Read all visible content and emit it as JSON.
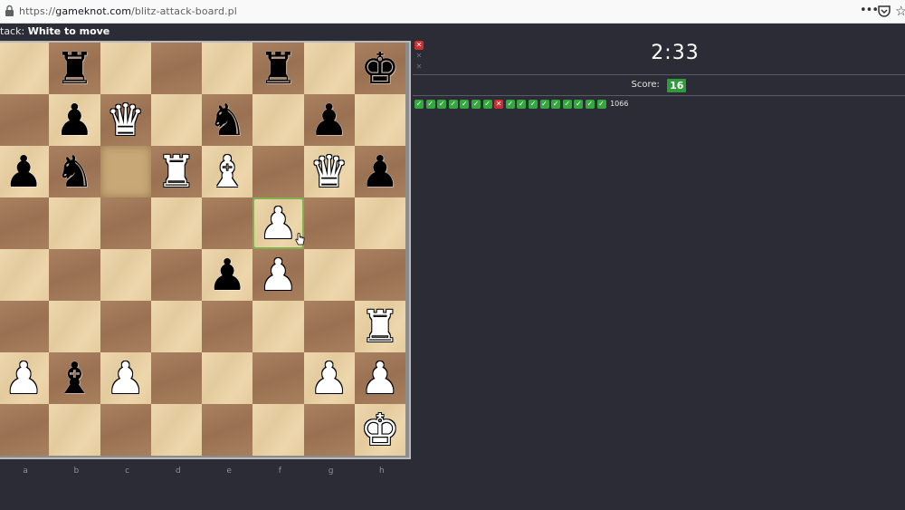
{
  "browser": {
    "url_prefix": "https://",
    "url_host": "gameknot.com",
    "url_path": "/blitz-attack-board.pl",
    "icons": [
      "lock-icon",
      "more-icon",
      "pocket-icon",
      "star-icon"
    ]
  },
  "puzzle": {
    "mode_label": "tack:",
    "turn_label": "White to move"
  },
  "board": {
    "files": [
      "a",
      "b",
      "c",
      "d",
      "e",
      "f",
      "g",
      "h"
    ],
    "rows": [
      [
        "",
        "bR",
        "",
        "",
        "",
        "bR",
        "",
        "bK"
      ],
      [
        "",
        "bP",
        "wQ",
        "",
        "bN",
        "",
        "bP",
        ""
      ],
      [
        "bP",
        "bN",
        "",
        "wR",
        "wB",
        "",
        "wQ",
        "bP"
      ],
      [
        "",
        "",
        "",
        "",
        "",
        "wP",
        "",
        ""
      ],
      [
        "",
        "",
        "",
        "",
        "bP",
        "wP",
        "",
        ""
      ],
      [
        "",
        "",
        "",
        "",
        "",
        "",
        "",
        "wR"
      ],
      [
        "wP",
        "bB",
        "wP",
        "",
        "",
        "",
        "wP",
        "wP"
      ],
      [
        "",
        "",
        "",
        "",
        "",
        "",
        "",
        "wK"
      ]
    ],
    "highlight_last_move": "c6",
    "selected_square": "f5",
    "colors": {
      "light": "#ecd3a4",
      "dark": "#a57a58",
      "selected_border": "#7fb24d"
    }
  },
  "side": {
    "status_icons": [
      "miss",
      "empty",
      "empty"
    ],
    "timer": "2:33",
    "score_label": "Score:",
    "score_value": "16",
    "results": [
      "ok",
      "ok",
      "ok",
      "ok",
      "ok",
      "ok",
      "ok",
      "fail",
      "ok",
      "ok",
      "ok",
      "ok",
      "ok",
      "ok",
      "ok",
      "ok",
      "ok"
    ],
    "results_count": "1066",
    "colors": {
      "ok": "#34a83f",
      "fail": "#cc2f2f",
      "score_badge": "#2e9a3a",
      "background": "#2c2c37"
    }
  }
}
